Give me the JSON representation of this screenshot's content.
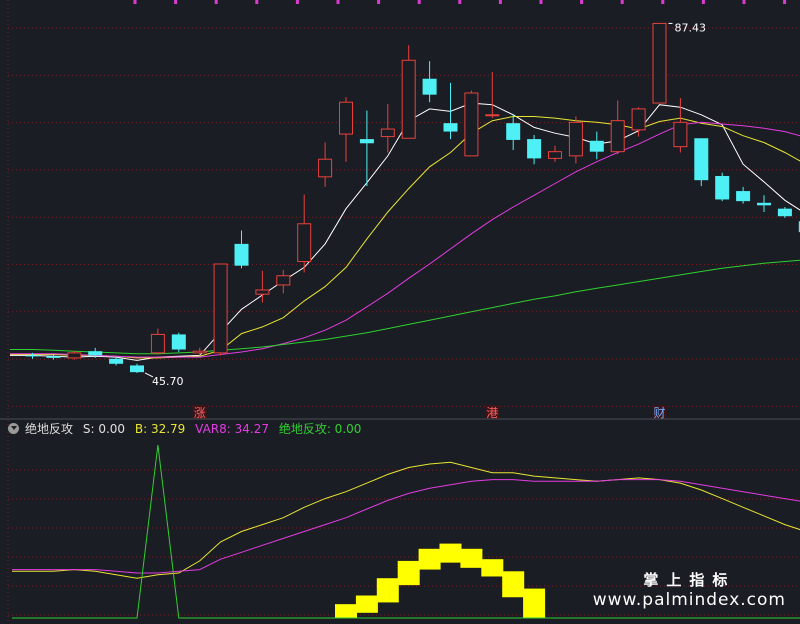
{
  "colors": {
    "up": "#e8413c",
    "down": "#4ef0f5",
    "ma5": "#ffffff",
    "ma10": "#e7e533",
    "ma20": "#e33ce0",
    "ma60": "#2fd02f",
    "S": "#e0e0e0",
    "B": "#e7e533",
    "VAR8": "#e33ce0",
    "juedi": "#2fd02f",
    "grid": "#7a1e24"
  },
  "chart_data": [
    {
      "type": "candlestick",
      "title": "",
      "ylim": [
        42,
        89
      ],
      "high_label": "87.43",
      "low_label": "45.70",
      "markers": [
        "涨",
        "港",
        "财"
      ],
      "marker_colors": [
        "#ff6060",
        "#ff6060",
        "#6fb0ff"
      ],
      "candles": [
        {
          "o": 47.8,
          "c": 47.7,
          "h": 48.1,
          "l": 47.4
        },
        {
          "o": 47.7,
          "c": 47.5,
          "h": 48.0,
          "l": 47.3
        },
        {
          "o": 47.5,
          "c": 48.1,
          "h": 48.3,
          "l": 47.3
        },
        {
          "o": 48.3,
          "c": 47.8,
          "h": 48.7,
          "l": 47.5
        },
        {
          "o": 47.4,
          "c": 46.8,
          "h": 47.6,
          "l": 46.6
        },
        {
          "o": 46.6,
          "c": 45.8,
          "h": 46.8,
          "l": 45.7
        },
        {
          "o": 48.1,
          "c": 50.3,
          "h": 51.0,
          "l": 47.9
        },
        {
          "o": 50.3,
          "c": 48.5,
          "h": 50.5,
          "l": 48.2
        },
        {
          "o": 48.1,
          "c": 48.3,
          "h": 48.7,
          "l": 47.8
        },
        {
          "o": 48.1,
          "c": 58.7,
          "h": 58.7,
          "l": 47.8
        },
        {
          "o": 61.1,
          "c": 58.5,
          "h": 62.7,
          "l": 58.2
        },
        {
          "o": 55.1,
          "c": 55.6,
          "h": 57.9,
          "l": 54.1
        },
        {
          "o": 56.2,
          "c": 57.3,
          "h": 58.0,
          "l": 55.2
        },
        {
          "o": 59.0,
          "c": 63.5,
          "h": 67.0,
          "l": 57.7
        },
        {
          "o": 69.1,
          "c": 71.2,
          "h": 73.2,
          "l": 67.9
        },
        {
          "o": 74.2,
          "c": 78.0,
          "h": 78.6,
          "l": 70.9
        },
        {
          "o": 73.6,
          "c": 73.1,
          "h": 77.0,
          "l": 68.0
        },
        {
          "o": 73.9,
          "c": 74.8,
          "h": 77.8,
          "l": 72.0
        },
        {
          "o": 73.7,
          "c": 83.0,
          "h": 84.8,
          "l": 73.7
        },
        {
          "o": 80.8,
          "c": 78.9,
          "h": 82.9,
          "l": 78.0
        },
        {
          "o": 75.5,
          "c": 74.5,
          "h": 80.3,
          "l": 73.6
        },
        {
          "o": 71.6,
          "c": 79.1,
          "h": 79.4,
          "l": 71.6
        },
        {
          "o": 76.4,
          "c": 76.5,
          "h": 81.6,
          "l": 76.1
        },
        {
          "o": 75.5,
          "c": 73.5,
          "h": 76.6,
          "l": 72.3
        },
        {
          "o": 73.6,
          "c": 71.3,
          "h": 74.1,
          "l": 70.6
        },
        {
          "o": 71.3,
          "c": 72.1,
          "h": 72.8,
          "l": 70.9
        },
        {
          "o": 71.6,
          "c": 75.6,
          "h": 76.3,
          "l": 70.7
        },
        {
          "o": 73.4,
          "c": 72.1,
          "h": 74.5,
          "l": 71.2
        },
        {
          "o": 72.1,
          "c": 75.8,
          "h": 78.2,
          "l": 71.8
        },
        {
          "o": 74.7,
          "c": 77.2,
          "h": 77.4,
          "l": 73.9
        },
        {
          "o": 77.9,
          "c": 87.4,
          "h": 87.4,
          "l": 77.9
        },
        {
          "o": 72.7,
          "c": 75.6,
          "h": 78.5,
          "l": 72.0
        },
        {
          "o": 73.7,
          "c": 68.7,
          "h": 73.7,
          "l": 68.0
        },
        {
          "o": 69.2,
          "c": 66.4,
          "h": 69.6,
          "l": 66.2
        },
        {
          "o": 67.4,
          "c": 66.2,
          "h": 67.9,
          "l": 65.9
        },
        {
          "o": 66.0,
          "c": 65.7,
          "h": 66.9,
          "l": 64.9
        },
        {
          "o": 65.3,
          "c": 64.4,
          "h": 65.5,
          "l": 64.2
        },
        {
          "o": 63.8,
          "c": 62.5,
          "h": 63.9,
          "l": 62.3
        },
        {
          "o": 62.4,
          "c": 63.3,
          "h": 63.8,
          "l": 62.3
        }
      ],
      "series": [
        {
          "key": "ma5",
          "values": [
            47.8,
            47.7,
            47.6,
            47.7,
            47.6,
            47.2,
            47.6,
            47.7,
            47.8,
            50.6,
            53.3,
            55.0,
            56.7,
            58.3,
            61.1,
            65.3,
            68.4,
            71.6,
            75.8,
            77.2,
            76.9,
            77.9,
            77.7,
            76.5,
            75.0,
            74.3,
            73.8,
            73.0,
            73.4,
            74.6,
            77.7,
            77.4,
            76.5,
            75.3,
            70.6,
            68.5,
            66.3,
            64.7,
            63.8
          ]
        },
        {
          "key": "ma10",
          "values": [
            47.9,
            47.9,
            47.8,
            47.8,
            47.7,
            47.5,
            47.5,
            47.6,
            47.7,
            48.4,
            50.4,
            51.2,
            52.3,
            54.3,
            56.0,
            58.3,
            61.7,
            64.9,
            67.7,
            70.3,
            72.0,
            74.3,
            75.8,
            76.3,
            76.3,
            76.1,
            75.8,
            75.6,
            75.3,
            74.8,
            75.7,
            76.1,
            75.5,
            75.1,
            74.0,
            73.2,
            72.0,
            70.6,
            69.5
          ]
        },
        {
          "key": "ma20",
          "values": [
            48.0,
            48.0,
            47.9,
            47.8,
            47.7,
            47.6,
            47.6,
            47.6,
            47.6,
            47.9,
            48.2,
            48.6,
            49.2,
            49.9,
            50.8,
            52.0,
            53.6,
            55.2,
            57.0,
            58.7,
            60.5,
            62.3,
            64.0,
            65.5,
            66.9,
            68.3,
            69.7,
            70.9,
            72.0,
            73.0,
            74.2,
            75.3,
            75.6,
            75.4,
            75.2,
            74.9,
            74.5,
            73.8,
            73.1
          ]
        },
        {
          "key": "ma60",
          "values": [
            48.5,
            48.4,
            48.3,
            48.2,
            48.1,
            48.0,
            48.0,
            48.1,
            48.2,
            48.4,
            48.6,
            48.8,
            49.1,
            49.4,
            49.7,
            50.1,
            50.5,
            51.0,
            51.5,
            52.0,
            52.5,
            53.0,
            53.5,
            54.0,
            54.5,
            54.9,
            55.4,
            55.8,
            56.2,
            56.6,
            57.0,
            57.4,
            57.8,
            58.2,
            58.5,
            58.8,
            59.0,
            59.2,
            59.4
          ]
        }
      ]
    },
    {
      "type": "line",
      "title": "绝地反攻",
      "ylim": [
        0,
        100
      ],
      "legend": [
        {
          "key": "S",
          "label": "S: 0.00"
        },
        {
          "key": "B",
          "label": "B: 32.79"
        },
        {
          "key": "VAR8",
          "label": "VAR8: 34.27"
        },
        {
          "key": "juedi",
          "label": "绝地反攻: 0.00"
        }
      ],
      "series": [
        {
          "key": "B",
          "values": [
            27,
            27,
            28,
            27,
            25,
            23,
            25,
            26,
            33,
            44,
            50,
            54,
            58,
            64,
            69,
            73,
            78,
            83,
            87,
            89,
            90,
            87,
            84,
            84,
            82,
            81,
            80,
            79,
            80,
            81,
            80,
            78,
            74,
            69,
            64,
            59,
            54,
            50,
            45
          ]
        },
        {
          "key": "VAR8",
          "values": [
            28,
            28,
            28,
            28,
            27,
            26,
            26,
            27,
            28,
            34,
            38,
            42,
            46,
            50,
            54,
            58,
            63,
            68,
            72,
            75,
            77,
            79,
            80,
            80,
            79,
            79,
            79,
            79,
            80,
            80,
            80,
            79,
            77,
            75,
            73,
            71,
            69,
            67,
            64
          ]
        },
        {
          "key": "juedi",
          "values": [
            0,
            0,
            0,
            0,
            0,
            0,
            100,
            0,
            0,
            0,
            0,
            0,
            0,
            0,
            0,
            0,
            0,
            0,
            0,
            0,
            0,
            0,
            0,
            0,
            0,
            0,
            0,
            0,
            0,
            0,
            0,
            0,
            0,
            0,
            0,
            0,
            0,
            0,
            0
          ]
        }
      ],
      "bars": [
        {
          "i": 15,
          "lo": 0,
          "hi": 8
        },
        {
          "i": 16,
          "lo": 3,
          "hi": 13
        },
        {
          "i": 17,
          "lo": 9,
          "hi": 23
        },
        {
          "i": 18,
          "lo": 19,
          "hi": 33
        },
        {
          "i": 19,
          "lo": 28,
          "hi": 40
        },
        {
          "i": 20,
          "lo": 32,
          "hi": 43
        },
        {
          "i": 21,
          "lo": 29,
          "hi": 40
        },
        {
          "i": 22,
          "lo": 24,
          "hi": 34
        },
        {
          "i": 23,
          "lo": 12,
          "hi": 27
        },
        {
          "i": 24,
          "lo": 0,
          "hi": 17
        }
      ]
    }
  ],
  "watermark": {
    "title": "掌上指标",
    "url": "www.palmindex.com"
  }
}
